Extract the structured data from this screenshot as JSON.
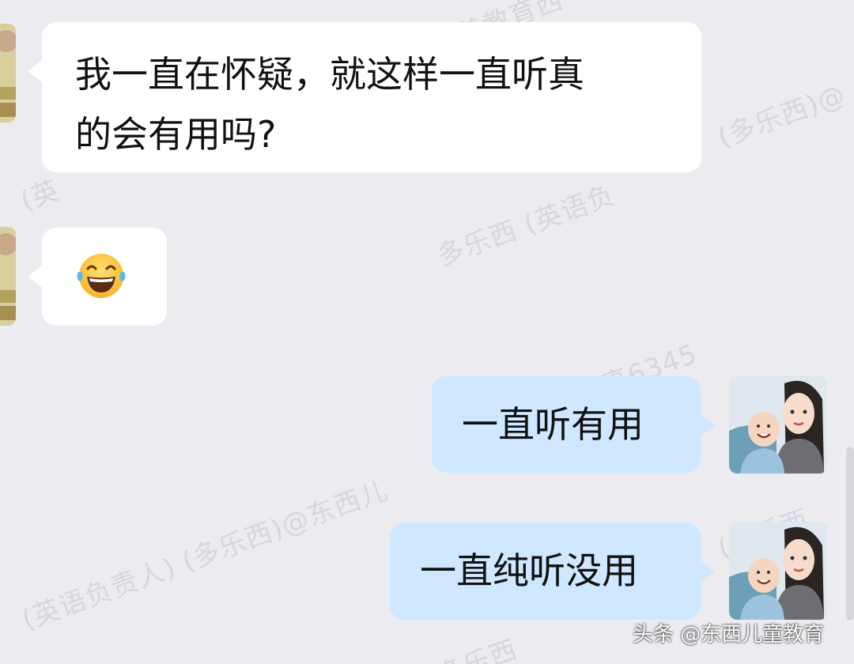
{
  "watermarks": [
    "养教育西",
    "(英",
    "(多乐西)@",
    "多乐西 (英语负",
    "张亮6345",
    "(英语负责人) (多乐西)@东西儿",
    "(多乐西",
    "多乐西"
  ],
  "messages": [
    {
      "direction": "in",
      "line1": "我一直在怀疑，就这样一直听真",
      "line2": "的会有用吗?"
    },
    {
      "direction": "in",
      "emoji": "laughing-tears-emoji"
    },
    {
      "direction": "out",
      "text": "一直听有用"
    },
    {
      "direction": "out",
      "text": "一直纯听没用"
    }
  ],
  "footer": {
    "credit": "头条 @东西儿童教育"
  },
  "colors": {
    "background": "#ebebf0",
    "incoming_bubble": "#ffffff",
    "outgoing_bubble": "#cfe8ff",
    "text": "#111111"
  }
}
